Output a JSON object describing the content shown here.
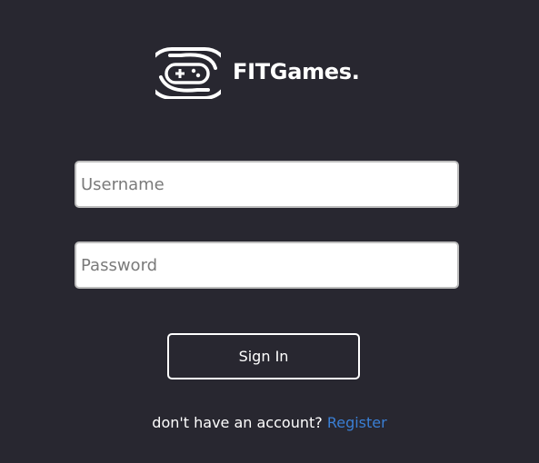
{
  "brand": {
    "name": "FITGames.",
    "logo_icon": "gamepad-icon"
  },
  "form": {
    "username_placeholder": "Username",
    "password_placeholder": "Password",
    "signin_label": "Sign In"
  },
  "footer": {
    "prompt": "don't have an account?",
    "register_label": "Register"
  },
  "colors": {
    "background": "#282730",
    "text": "#ffffff",
    "link": "#3a7fd4",
    "input_border": "#bdbdbd"
  }
}
